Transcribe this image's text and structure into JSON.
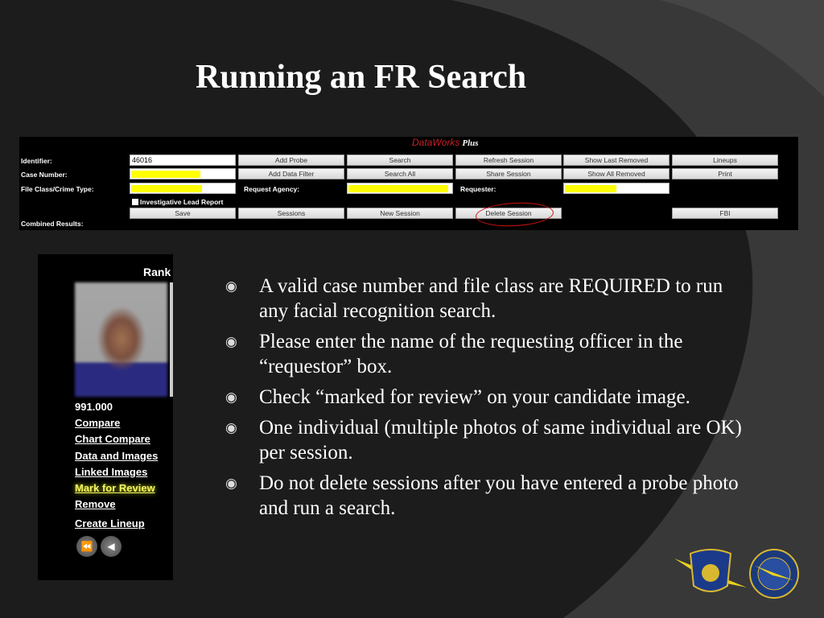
{
  "slide": {
    "title": "Running an FR Search"
  },
  "app": {
    "brand": "DataWorks",
    "brand_suffix": "Plus",
    "labels": {
      "identifier": "Identifier:",
      "case_number": "Case Number:",
      "file_class": "File Class/Crime Type:",
      "request_agency": "Request Agency:",
      "requester": "Requester:",
      "combined_results": "Combined Results:"
    },
    "identifier_value": "46016",
    "checkbox_label": "Investigative Lead Report",
    "buttons": {
      "add_probe": "Add Probe",
      "search": "Search",
      "refresh_session": "Refresh Session",
      "show_last_removed": "Show Last Removed",
      "lineups": "Lineups",
      "add_data_filter": "Add Data Filter",
      "search_all": "Search All",
      "share_session": "Share Session",
      "show_all_removed": "Show All Removed",
      "print": "Print",
      "save": "Save",
      "sessions": "Sessions",
      "new_session": "New Session",
      "delete_session": "Delete Session",
      "fbi": "FBI"
    }
  },
  "results": {
    "rank_header": "Rank",
    "score": "991.000",
    "links": [
      "Compare",
      "Chart Compare",
      "Data and Images",
      "Linked Images",
      "Mark for Review",
      "Remove",
      "Create Lineup"
    ]
  },
  "bullets": [
    "A valid case number and file class are REQUIRED to run any facial recognition search.",
    "Please enter the name of the requesting officer in the “requestor” box.",
    "Check “marked for review” on your candidate image.",
    "One individual (multiple photos of same individual are OK) per session.",
    "Do not delete sessions after you have entered a probe photo and run a search."
  ],
  "logos": {
    "msp": "MICHIGAN STATE POLICE"
  },
  "colors": {
    "highlight": "#ffff00",
    "annotation": "#d01010",
    "brand": "#c8202a"
  }
}
